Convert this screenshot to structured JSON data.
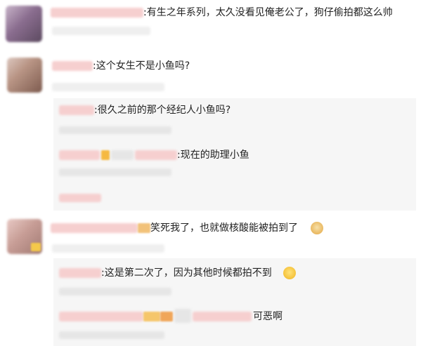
{
  "comments": [
    {
      "text": ":有生之年系列，太久没看见俺老公了，狗仔偷拍都这么帅"
    },
    {
      "text": ":这个女生不是小鱼吗?",
      "replies": [
        {
          "text": ":很久之前的那个经纪人小鱼吗?"
        },
        {
          "text": ":现在的助理小鱼"
        }
      ]
    },
    {
      "text": "笑死我了，也就做核酸能被拍到了",
      "replies": [
        {
          "text": ":这是第二次了，因为其他时候都拍不到"
        },
        {
          "text": "可恶啊"
        }
      ]
    }
  ],
  "emojis": {
    "doge": "doge-emoji",
    "laughcry": "laugh-cry-emoji"
  }
}
